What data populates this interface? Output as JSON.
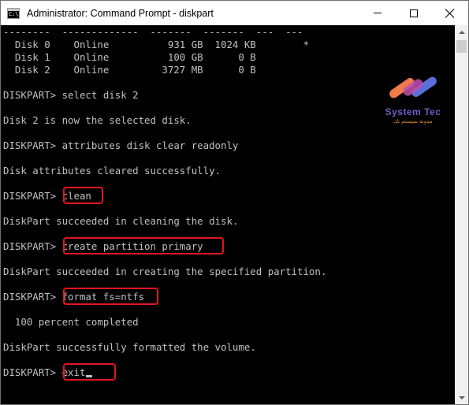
{
  "window": {
    "title": "Administrator: Command Prompt - diskpart",
    "app_icon_text": "C:\\"
  },
  "console": {
    "lines": [
      "--------  -------------  -------  -------  ---  ---",
      "  Disk 0    Online          931 GB  1024 KB        *",
      "  Disk 1    Online          100 GB      0 B",
      "  Disk 2    Online         3727 MB      0 B",
      "",
      "DISKPART> select disk 2",
      "",
      "Disk 2 is now the selected disk.",
      "",
      "DISKPART> attributes disk clear readonly",
      "",
      "Disk attributes cleared successfully.",
      "",
      "DISKPART> clean",
      "",
      "DiskPart succeeded in cleaning the disk.",
      "",
      "DISKPART> create partition primary",
      "",
      "DiskPart succeeded in creating the specified partition.",
      "",
      "DISKPART> format fs=ntfs",
      "",
      "  100 percent completed",
      "",
      "DiskPart successfully formatted the volume.",
      "",
      "DISKPART> exit"
    ]
  },
  "watermark": {
    "title": "System Tec",
    "subtitle": "مدونة سيستم تك"
  },
  "colors": {
    "console_bg": "#000000",
    "console_text": "#c0c0c0",
    "highlight_box": "#e0161d",
    "logo_primary": "#6d5ec7",
    "logo_accent": "#e88a3c"
  }
}
